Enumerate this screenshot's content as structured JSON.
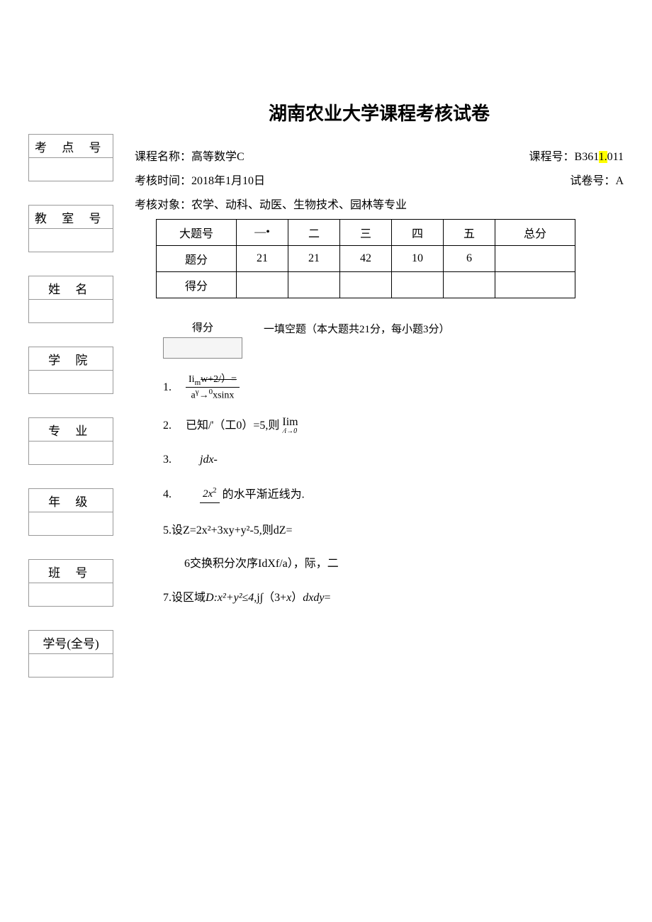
{
  "doc_title": "湖南农业大学课程考核试卷",
  "meta": {
    "course_label": "课程名称：",
    "course_name": "高等数学C",
    "course_no_label": "课程号：",
    "course_no_pre": "B361",
    "course_no_hl": "1.",
    "course_no_post": "011",
    "time_label": "考核时间：",
    "time_value": "2018年1月10日",
    "paper_no_label": "试卷号：",
    "paper_no_value": "A",
    "target_label": "考核对象：",
    "target_value": "农学、动科、动医、生物技术、园林等专业"
  },
  "sidebar": {
    "labels": [
      "考 点 号",
      "教 室 号",
      "姓   名",
      "学   院",
      "专   业",
      "年   级",
      "班   号",
      "学号(全号)"
    ]
  },
  "score_table": {
    "headers": [
      "大题号",
      "—•",
      "二",
      "三",
      "四",
      "五",
      "总分"
    ],
    "points_row_label": "题分",
    "points": [
      "21",
      "21",
      "42",
      "10",
      "6",
      ""
    ],
    "got_row_label": "得分"
  },
  "section": {
    "score_label": "得分",
    "title": "一填空题（本大题共21分，每小题3分）"
  },
  "questions": {
    "q1": {
      "num": "1.",
      "top_a": "Ii",
      "top_b": "m",
      "top_c": "w+2/）=",
      "bot_a": "a",
      "bot_b": "γ",
      "bot_c": "→",
      "bot_d": "0",
      "bot_e": "xsinx"
    },
    "q2": {
      "num": "2.",
      "text_a": "已知/'（工0）=5,则",
      "lim_main": "Iim",
      "lim_under": "∕i→0"
    },
    "q3": {
      "num": "3.",
      "text": "jdx-"
    },
    "q4": {
      "num": "4.",
      "frac_top": "2x",
      "frac_top_sup": "2",
      "tail": " 的水平渐近线为."
    },
    "q5": {
      "num": "5.",
      "text": "设Z=2x²+3xy+y²-5,则dZ="
    },
    "q6": {
      "num": "6",
      "text": "交换积分次序IdXf/a），际，二"
    },
    "q7": {
      "num": "7.",
      "text_a": "设区域",
      "text_b": "D:x²+y²≤4",
      "text_c": ",j∫（3+",
      "text_d": "x",
      "text_e": "）",
      "text_f": "dxdy",
      "text_g": "="
    }
  }
}
